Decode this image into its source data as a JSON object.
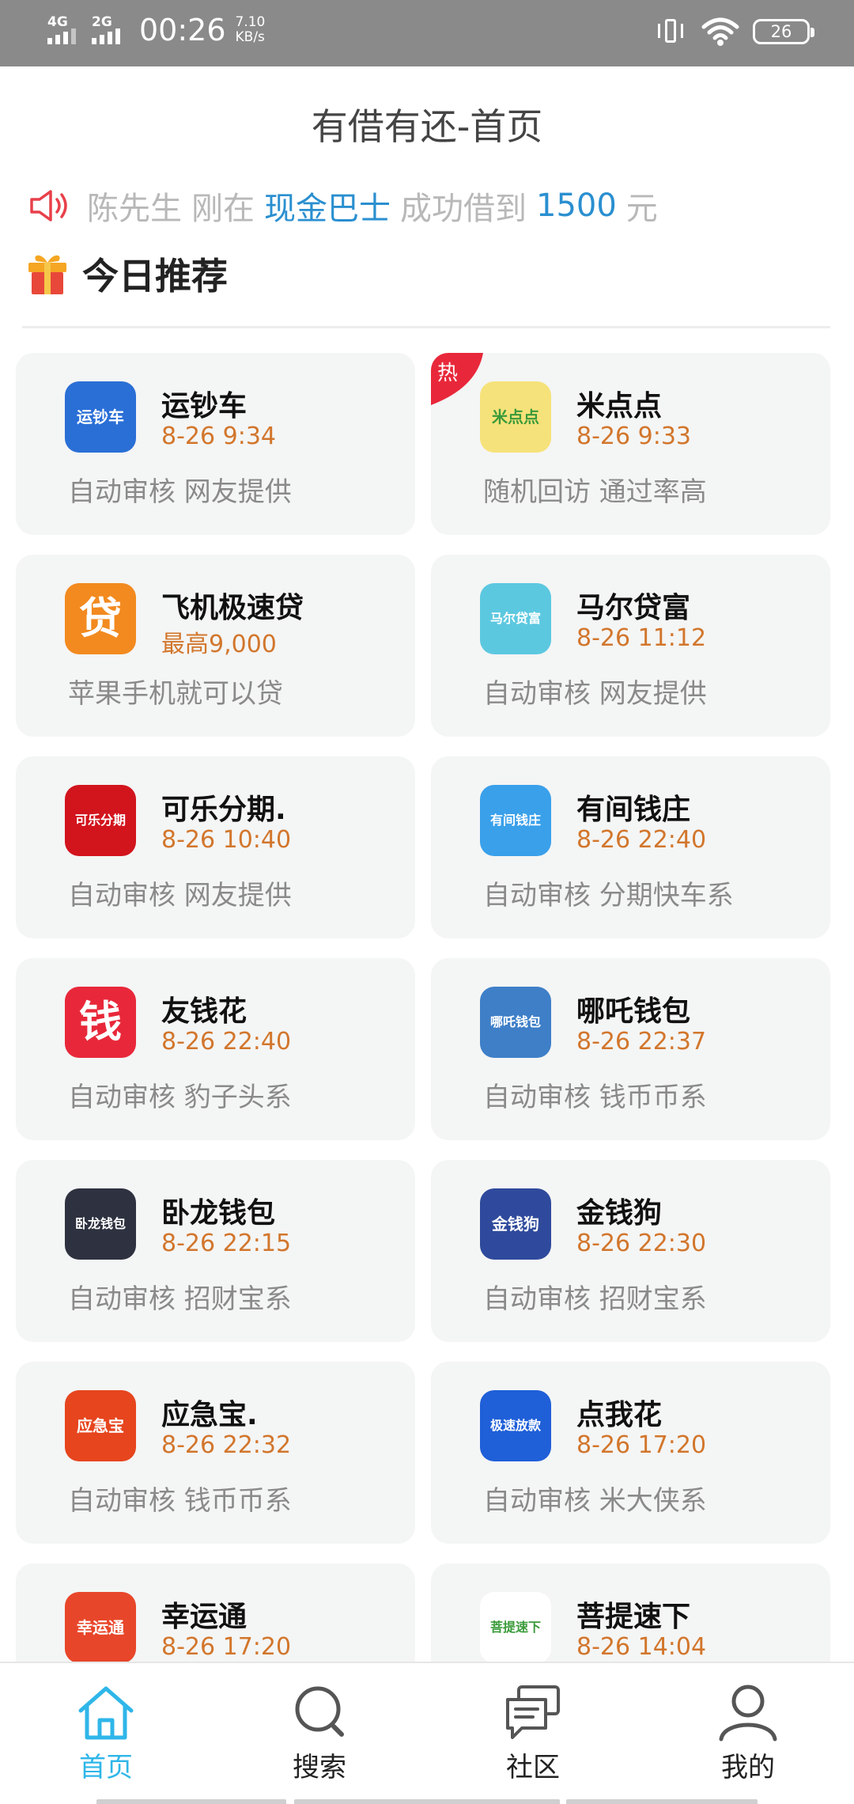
{
  "status_bar": {
    "sim1": "4G",
    "sim2": "2G",
    "time": "00:26",
    "speed_value": "7.10",
    "speed_unit": "KB/s",
    "battery": "26"
  },
  "header": {
    "title": "有借有还-首页"
  },
  "notice": {
    "icon": "speaker-icon",
    "user": "陈先生",
    "verb": "刚在",
    "platform": "现金巴士",
    "result": "成功借到",
    "amount": "1500",
    "unit": "元"
  },
  "section": {
    "icon": "gift-icon",
    "title": "今日推荐"
  },
  "hot_badge": "热",
  "cards": [
    {
      "name": "运钞车",
      "time": "8-26 9:34",
      "desc": "自动审核 网友提供",
      "icon_text": "运钞车",
      "icon_color": "#2a6fd6"
    },
    {
      "name": "米点点",
      "time": "8-26 9:33",
      "desc": "随机回访 通过率高",
      "icon_text": "米点点",
      "icon_color": "#f6e27a"
    },
    {
      "name": "飞机极速贷",
      "time": "最高9,000",
      "desc": "苹果手机就可以贷",
      "icon_text": "贷",
      "icon_color": "#f28a1f"
    },
    {
      "name": "马尔贷富",
      "time": "8-26 11:12",
      "desc": "自动审核 网友提供",
      "icon_text": "马尔贷富",
      "icon_color": "#5cc8e0"
    },
    {
      "name": "可乐分期.",
      "time": "8-26 10:40",
      "desc": "自动审核 网友提供",
      "icon_text": "可乐分期",
      "icon_color": "#d2141d"
    },
    {
      "name": "有间钱庄",
      "time": "8-26 22:40",
      "desc": "自动审核 分期快车系",
      "icon_text": "有间钱庄",
      "icon_color": "#3aa0ea"
    },
    {
      "name": "友钱花",
      "time": "8-26 22:40",
      "desc": "自动审核 豹子头系",
      "icon_text": "钱",
      "icon_color": "#e8283a"
    },
    {
      "name": "哪吒钱包",
      "time": "8-26 22:37",
      "desc": "自动审核 钱币币系",
      "icon_text": "哪吒钱包",
      "icon_color": "#3e7fc8"
    },
    {
      "name": "卧龙钱包",
      "time": "8-26 22:15",
      "desc": "自动审核 招财宝系",
      "icon_text": "卧龙钱包",
      "icon_color": "#2e3240"
    },
    {
      "name": "金钱狗",
      "time": "8-26 22:30",
      "desc": "自动审核 招财宝系",
      "icon_text": "金钱狗",
      "icon_color": "#2f4a9c"
    },
    {
      "name": "应急宝.",
      "time": "8-26 22:32",
      "desc": "自动审核 钱币币系",
      "icon_text": "应急宝",
      "icon_color": "#e6451e"
    },
    {
      "name": "点我花",
      "time": "8-26 17:20",
      "desc": "自动审核 米大侠系",
      "icon_text": "极速放款",
      "icon_color": "#1f5fd8"
    },
    {
      "name": "幸运通",
      "time": "8-26 17:20",
      "desc": "",
      "icon_text": "幸运通",
      "icon_color": "#e8462a"
    },
    {
      "name": "菩提速下",
      "time": "8-26 14:04",
      "desc": "",
      "icon_text": "菩提速下",
      "icon_color": "#ffffff"
    }
  ],
  "nav": {
    "items": [
      {
        "label": "首页",
        "icon": "home-icon",
        "active": true
      },
      {
        "label": "搜索",
        "icon": "search-icon",
        "active": false
      },
      {
        "label": "社区",
        "icon": "chat-icon",
        "active": false
      },
      {
        "label": "我的",
        "icon": "user-icon",
        "active": false
      }
    ],
    "active_color": "#2fb6e8"
  },
  "colors": {
    "accent_blue": "#2a8fd0",
    "time_orange": "#d2762c",
    "hot_red": "#e8283a"
  }
}
